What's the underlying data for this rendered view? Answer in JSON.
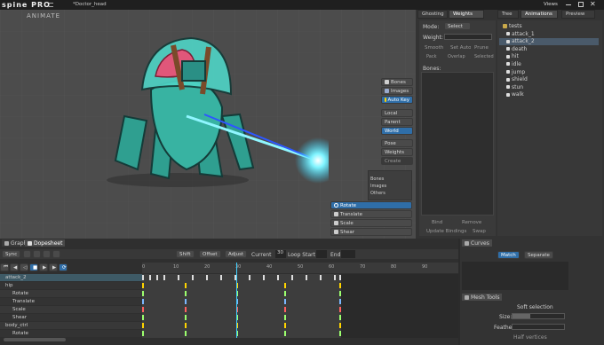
{
  "titlebar": {
    "app_logo": "spine PRO",
    "file_title": "*Doctor_head",
    "views_label": "Views"
  },
  "viewport": {
    "mode_label": "ANIMATE",
    "side_buttons": [
      "Bones",
      "Images",
      "Auto Key"
    ],
    "transform_buttons": [
      "Local",
      "Parent",
      "World"
    ],
    "pose_buttons": [
      "Pose",
      "Weights",
      "Create"
    ],
    "filter_rows": [
      "Bones",
      "Images",
      "Others"
    ],
    "tool_buttons": [
      "Rotate",
      "Translate",
      "Scale",
      "Shear"
    ]
  },
  "weights_panel": {
    "tabs": [
      "Ghosting",
      "Weights",
      "Tree",
      "Animations",
      "Preview"
    ],
    "mode_label": "Mode:",
    "mode_value": "Select",
    "weight_label": "Weight:",
    "buttons_row1": [
      "Smooth",
      "Set Auto",
      "Prune"
    ],
    "buttons_row2": [
      "Pack",
      "Overlap",
      "Selected"
    ],
    "bones_label": "Bones:",
    "bottom_buttons": [
      "Bind",
      "Remove"
    ],
    "update_bindings": "Update Bindings",
    "swap": "Swap"
  },
  "animations": {
    "root": "tests",
    "items": [
      "attack_1",
      "attack_2",
      "death",
      "hit",
      "idle",
      "jump",
      "shield",
      "stun",
      "walk"
    ],
    "selected_index": 1
  },
  "dopesheet": {
    "tabs": [
      "Graph",
      "Dopesheet"
    ],
    "toolbar": {
      "sync": "Sync",
      "shift": "Shift",
      "offset": "Offset",
      "adjust": "Adjust",
      "current_label": "Current",
      "current_value": "30",
      "loop_start": "Loop Start",
      "end": "End"
    },
    "ruler": [
      "0",
      "10",
      "20",
      "30",
      "40",
      "50",
      "60",
      "70",
      "80",
      "90"
    ],
    "tracks": [
      {
        "label": "attack_2",
        "kind": "anim"
      },
      {
        "label": "hip",
        "kind": "bone"
      },
      {
        "label": "Rotate",
        "kind": "prop"
      },
      {
        "label": "Translate",
        "kind": "prop"
      },
      {
        "label": "Scale",
        "kind": "prop"
      },
      {
        "label": "Shear",
        "kind": "prop"
      },
      {
        "label": "body_ctrl",
        "kind": "bone"
      },
      {
        "label": "Rotate",
        "kind": "prop"
      }
    ]
  },
  "curves": {
    "title": "Curves",
    "match": "Match",
    "separate": "Separate"
  },
  "mesh_tools": {
    "title": "Mesh Tools",
    "soft_selection": "Soft selection",
    "size_label": "Size:",
    "feather_label": "Feather:",
    "half_vertices": "Half vertices"
  },
  "colors": {
    "accent_blue": "#2f6ea8",
    "key_green": "#9cff6e",
    "playhead": "#3fd0ff"
  }
}
